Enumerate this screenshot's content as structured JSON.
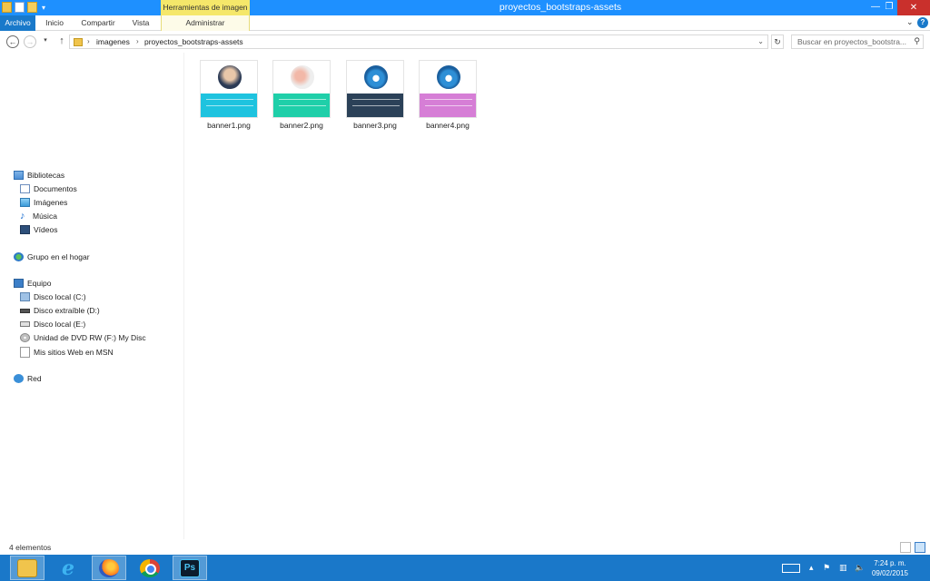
{
  "window": {
    "title": "proyectos_bootstraps-assets",
    "context_tab_group": "Herramientas de imagen",
    "controls": {
      "minimize": "—",
      "maximize": "❐",
      "close": "✕"
    }
  },
  "ribbon": {
    "tabs": [
      "Archivo",
      "Inicio",
      "Compartir",
      "Vista",
      "Administrar"
    ]
  },
  "address_bar": {
    "crumbs": [
      "imagenes",
      "proyectos_bootstraps-assets"
    ],
    "search_placeholder": "Buscar en proyectos_bootstra..."
  },
  "navigation": {
    "libraries": {
      "label": "Bibliotecas",
      "items": [
        "Documentos",
        "Imágenes",
        "Música",
        "Vídeos"
      ]
    },
    "homegroup": "Grupo en el hogar",
    "computer": {
      "label": "Equipo",
      "items": [
        "Disco local (C:)",
        "Disco extraíble (D:)",
        "Disco local (E:)",
        "Unidad de DVD RW (F:) My Disc",
        "Mis sitios Web en MSN"
      ]
    },
    "network": "Red"
  },
  "files": [
    {
      "name": "banner1.png",
      "top_color": "#ffffff",
      "bottom_color": "#1ec3df",
      "circle": "photo"
    },
    {
      "name": "banner2.png",
      "top_color": "#ffffff",
      "bottom_color": "#1fcfa9",
      "circle": "hand"
    },
    {
      "name": "banner3.png",
      "top_color": "#ffffff",
      "bottom_color": "#2b4158",
      "circle": "car"
    },
    {
      "name": "banner4.png",
      "top_color": "#ffffff",
      "bottom_color": "#d67ed6",
      "circle": "car"
    }
  ],
  "status": {
    "item_count": "4 elementos"
  },
  "taskbar": {
    "apps": [
      "file-explorer",
      "internet-explorer",
      "firefox",
      "chrome",
      "photoshop"
    ],
    "clock": {
      "time": "7:24 p. m.",
      "date": "09/02/2015"
    }
  },
  "colors": {
    "accent": "#1979ca",
    "titlebar": "#1e90ff",
    "context_tab": "#f5e76a",
    "taskbar": "#1a78c9",
    "close": "#c9302c"
  }
}
